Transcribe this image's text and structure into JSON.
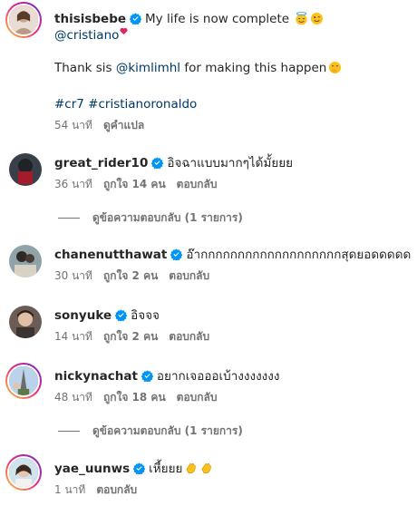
{
  "caption": {
    "username": "thisisbebe",
    "text": "My life is now complete",
    "mention": "@cristiano",
    "thanks_prefix": "Thank sis",
    "thanks_mention": "@kimlimhl",
    "thanks_suffix": "for making this happen",
    "hashtag_1": "#cr7",
    "hashtag_2": "#cristianoronaldo",
    "time": "54 นาที",
    "translate": "ดูคำแปล"
  },
  "comments": [
    {
      "username": "great_rider10",
      "text": "อิจฉาแบบมากๆได้มั้ยยย",
      "time": "36 นาที",
      "likes": "ถูกใจ 14 คน",
      "reply": "ตอบกลับ",
      "view_replies": "ดูข้อความตอบกลับ (1 รายการ)"
    },
    {
      "username": "chanenutthawat",
      "text": "อ๊ากกกกกกกกกกกกกกกกกกกสุดยอดดดดด",
      "time": "30 นาที",
      "likes": "ถูกใจ 2 คน",
      "reply": "ตอบกลับ"
    },
    {
      "username": "sonyuke",
      "text": "อิจจจ",
      "time": "14 นาที",
      "likes": "ถูกใจ 2 คน",
      "reply": "ตอบกลับ"
    },
    {
      "username": "nickynachat",
      "text": "อยากเจอออเบ้างงงงงงง",
      "time": "48 นาที",
      "likes": "ถูกใจ 18 คน",
      "reply": "ตอบกลับ",
      "view_replies": "ดูข้อความตอบกลับ (1 รายการ)"
    },
    {
      "username": "yae_uunws",
      "text": "เหี้ยยย",
      "time": "1 นาที",
      "reply": "ตอบกลับ"
    }
  ],
  "colors": {
    "verified": "#0095f6",
    "link": "#00376b",
    "muted": "#737373"
  }
}
